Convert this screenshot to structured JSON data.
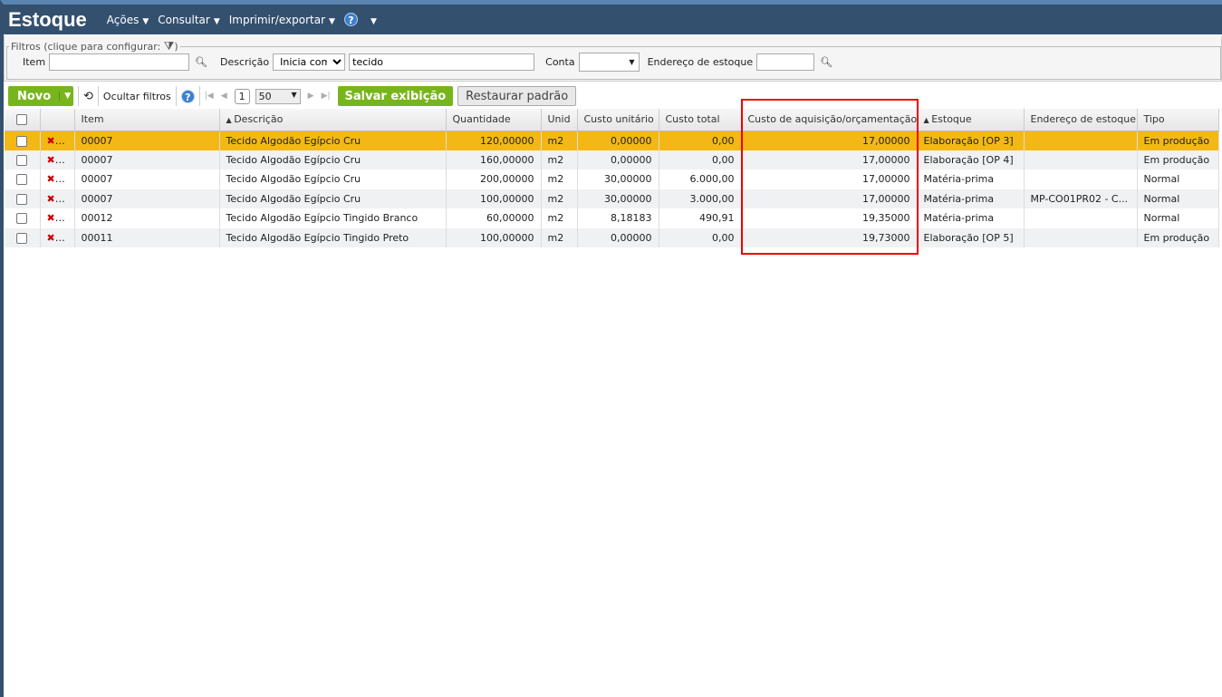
{
  "header": {
    "title": "Estoque",
    "menus": [
      "Ações",
      "Consultar",
      "Imprimir/exportar"
    ],
    "help": "?"
  },
  "filters": {
    "legend": "Filtros (clique para configurar:",
    "legend_close": ")",
    "item_label": "Item",
    "item_value": "",
    "descricao_label": "Descrição",
    "descricao_mode": "Inicia com",
    "descricao_value": "tecido",
    "conta_label": "Conta",
    "conta_value": "",
    "endereco_label": "Endereço de estoque",
    "endereco_value": ""
  },
  "toolbar": {
    "novo": "Novo",
    "ocultar": "Ocultar filtros",
    "page": "1",
    "page_size": "50",
    "salvar": "Salvar exibição",
    "restaurar": "Restaurar padrão"
  },
  "columns": [
    "Item",
    "Descrição",
    "Quantidade",
    "Unid",
    "Custo unitário",
    "Custo total",
    "Custo de aquisição/orçamentação",
    "Estoque",
    "Endereço de estoque",
    "Tipo"
  ],
  "rows": [
    [
      "00007",
      "Tecido Algodão Egípcio Cru",
      "120,00000",
      "m2",
      "0,00000",
      "0,00",
      "17,00000",
      "Elaboração [OP 3]",
      "",
      "Em produção"
    ],
    [
      "00007",
      "Tecido Algodão Egípcio Cru",
      "160,00000",
      "m2",
      "0,00000",
      "0,00",
      "17,00000",
      "Elaboração [OP 4]",
      "",
      "Em produção"
    ],
    [
      "00007",
      "Tecido Algodão Egípcio Cru",
      "200,00000",
      "m2",
      "30,00000",
      "6.000,00",
      "17,00000",
      "Matéria-prima",
      "",
      "Normal"
    ],
    [
      "00007",
      "Tecido Algodão Egípcio Cru",
      "100,00000",
      "m2",
      "30,00000",
      "3.000,00",
      "17,00000",
      "Matéria-prima",
      "MP-CO01PR02 - C...",
      "Normal"
    ],
    [
      "00012",
      "Tecido Algodão Egípcio Tingido Branco",
      "60,00000",
      "m2",
      "8,18183",
      "490,91",
      "19,35000",
      "Matéria-prima",
      "",
      "Normal"
    ],
    [
      "00011",
      "Tecido Algodão Egípcio Tingido Preto",
      "100,00000",
      "m2",
      "0,00000",
      "0,00",
      "19,73000",
      "Elaboração [OP 5]",
      "",
      "Em produção"
    ]
  ]
}
